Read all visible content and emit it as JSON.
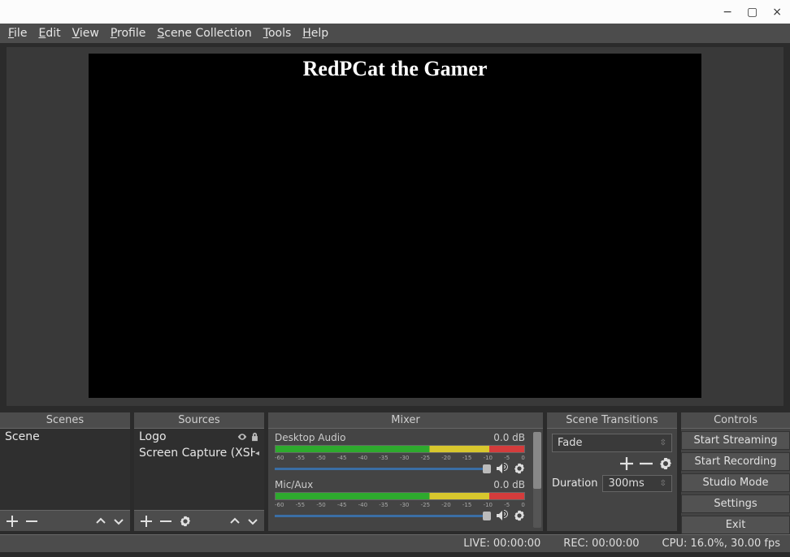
{
  "window": {
    "minimize": "−",
    "maximize": "▢",
    "close": "×"
  },
  "menu": {
    "file": "File",
    "edit": "Edit",
    "view": "View",
    "profile": "Profile",
    "scene_collection": "Scene Collection",
    "tools": "Tools",
    "help": "Help"
  },
  "preview": {
    "overlay_text": "RedPCat the Gamer"
  },
  "panels": {
    "scenes_title": "Scenes",
    "sources_title": "Sources",
    "mixer_title": "Mixer",
    "transitions_title": "Scene Transitions",
    "controls_title": "Controls"
  },
  "scenes": {
    "items": [
      "Scene"
    ]
  },
  "sources": {
    "items": [
      {
        "name": "Logo",
        "visible": true,
        "locked": true
      },
      {
        "name": "Screen Capture (XSHM)",
        "visible": true,
        "locked": false
      }
    ]
  },
  "mixer": {
    "channels": [
      {
        "name": "Desktop Audio",
        "level": "0.0 dB"
      },
      {
        "name": "Mic/Aux",
        "level": "0.0 dB"
      }
    ],
    "ticks": [
      "-60",
      "-55",
      "-50",
      "-45",
      "-40",
      "-35",
      "-30",
      "-25",
      "-20",
      "-15",
      "-10",
      "-5",
      "0"
    ]
  },
  "transitions": {
    "selected": "Fade",
    "duration_label": "Duration",
    "duration_value": "300ms"
  },
  "controls": {
    "start_streaming": "Start Streaming",
    "start_recording": "Start Recording",
    "studio_mode": "Studio Mode",
    "settings": "Settings",
    "exit": "Exit"
  },
  "status": {
    "live": "LIVE: 00:00:00",
    "rec": "REC: 00:00:00",
    "cpu": "CPU: 16.0%, 30.00 fps"
  },
  "icons": {
    "plus": "＋",
    "minus": "—",
    "up": "⌃",
    "down": "⌄",
    "gear": "⚙",
    "speaker": "🔊",
    "eye": "👁",
    "lock": "🔒",
    "spin": "⇳"
  }
}
